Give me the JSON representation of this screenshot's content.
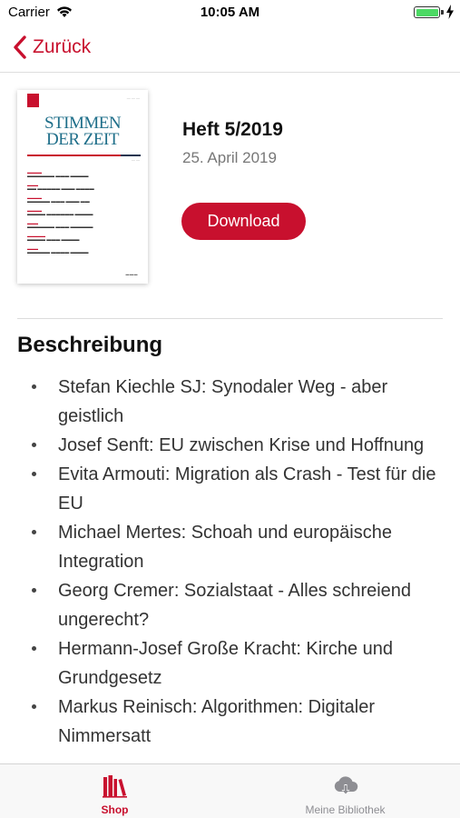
{
  "status_bar": {
    "carrier": "Carrier",
    "time": "10:05 AM",
    "wifi_icon": "wifi-icon",
    "battery_level": 1.0,
    "battery_color": "#4cd964"
  },
  "nav": {
    "back_label": "Zurück",
    "back_icon": "chevron-left-icon",
    "accent_color": "#c8102e"
  },
  "issue": {
    "title": "Heft 5/2019",
    "date": "25. April 2019",
    "download_label": "Download",
    "cover": {
      "magazine_title_line1": "STIMMEN",
      "magazine_title_line2": "DER ZEIT"
    }
  },
  "description": {
    "heading": "Beschreibung",
    "articles": [
      "Stefan Kiechle SJ: Synodaler Weg - aber geistlich",
      "Josef Senft: EU zwischen Krise und Hoffnung",
      "Evita Armouti: Migration als Crash - Test für die EU",
      "Michael Mertes: Schoah und europäische Integration",
      "Georg Cremer: Sozialstaat - Alles schreiend ungerecht?",
      "Hermann-Josef Große Kracht: Kirche und Grundgesetz",
      "Markus Reinisch: Algorithmen: Digitaler Nimmersatt"
    ]
  },
  "tab_bar": {
    "tabs": [
      {
        "label": "Shop",
        "icon": "books-icon",
        "active": true
      },
      {
        "label": "Meine Bibliothek",
        "icon": "cloud-download-icon",
        "active": false
      }
    ]
  }
}
